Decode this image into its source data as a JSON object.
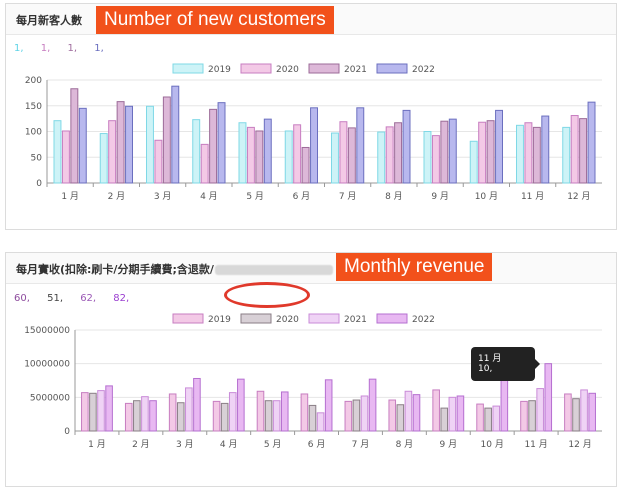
{
  "panels": [
    {
      "title": "每月新客人數",
      "tag": "Number of new customers",
      "totals": [
        "1,",
        "1,",
        "1,",
        "1,"
      ],
      "total_colors": [
        "#5fd3e6",
        "#c77dc0",
        "#a06d9e",
        "#6b6fbf"
      ]
    },
    {
      "title": "每月實收(扣除:刷卡/分期手續費;含退款/",
      "tag": "Monthly revenue",
      "totals": [
        "60,",
        "51,",
        "62,",
        "82,"
      ],
      "total_colors": [
        "#8e4c9e",
        "#444444",
        "#9b59b6",
        "#9b3fd0"
      ]
    }
  ],
  "tooltip": {
    "title": "11 月",
    "value": "10,"
  },
  "chart_data": [
    {
      "type": "bar",
      "categories": [
        "1 月",
        "2 月",
        "3 月",
        "4 月",
        "5 月",
        "6 月",
        "7 月",
        "8 月",
        "9 月",
        "10 月",
        "11 月",
        "12 月"
      ],
      "series": [
        {
          "name": "2019",
          "values": [
            121,
            96,
            149,
            123,
            117,
            101,
            97,
            99,
            100,
            81,
            112,
            108
          ],
          "color": "#cdf3f7",
          "stroke": "#7fd8e6"
        },
        {
          "name": "2020",
          "values": [
            101,
            121,
            83,
            75,
            108,
            113,
            119,
            109,
            92,
            118,
            117,
            131
          ],
          "color": "#f3c9e6",
          "stroke": "#c77dc0"
        },
        {
          "name": "2021",
          "values": [
            183,
            158,
            167,
            143,
            101,
            69,
            107,
            117,
            120,
            121,
            108,
            125
          ],
          "color": "#ddb8d8",
          "stroke": "#9c6b98"
        },
        {
          "name": "2022",
          "values": [
            145,
            149,
            188,
            156,
            124,
            146,
            146,
            141,
            124,
            141,
            130,
            157
          ],
          "color": "#b8b8ee",
          "stroke": "#6b6fbf"
        }
      ],
      "yticks": [
        0,
        50,
        100,
        150,
        200
      ],
      "ylim": [
        0,
        200
      ],
      "grid": true,
      "legend": "top"
    },
    {
      "type": "bar",
      "categories": [
        "1 月",
        "2 月",
        "3 月",
        "4 月",
        "5 月",
        "6 月",
        "7 月",
        "8 月",
        "9 月",
        "10 月",
        "11 月",
        "12 月"
      ],
      "series": [
        {
          "name": "2019",
          "values": [
            5700000,
            4100000,
            5500000,
            4400000,
            5900000,
            5500000,
            4400000,
            4600000,
            6100000,
            4000000,
            4400000,
            5500000
          ],
          "color": "#f3c9e6",
          "stroke": "#c77dc0"
        },
        {
          "name": "2020",
          "values": [
            5600000,
            4500000,
            4200000,
            4100000,
            4500000,
            3800000,
            4600000,
            3900000,
            3400000,
            3400000,
            4500000,
            4800000
          ],
          "color": "#d8d0d6",
          "stroke": "#8a7e86"
        },
        {
          "name": "2021",
          "values": [
            6000000,
            5100000,
            6400000,
            5700000,
            4500000,
            2700000,
            5200000,
            5900000,
            5000000,
            3700000,
            6300000,
            6100000
          ],
          "color": "#efd3f5",
          "stroke": "#c98bd8"
        },
        {
          "name": "2022",
          "values": [
            6700000,
            4500000,
            7800000,
            7700000,
            5800000,
            7600000,
            7700000,
            5400000,
            5200000,
            8100000,
            10000000,
            5600000
          ],
          "color": "#e8b8f2",
          "stroke": "#b56fd0"
        }
      ],
      "yticks": [
        0,
        5000000,
        10000000,
        15000000
      ],
      "ylim": [
        0,
        15000000
      ],
      "grid": true,
      "legend": "top"
    }
  ]
}
